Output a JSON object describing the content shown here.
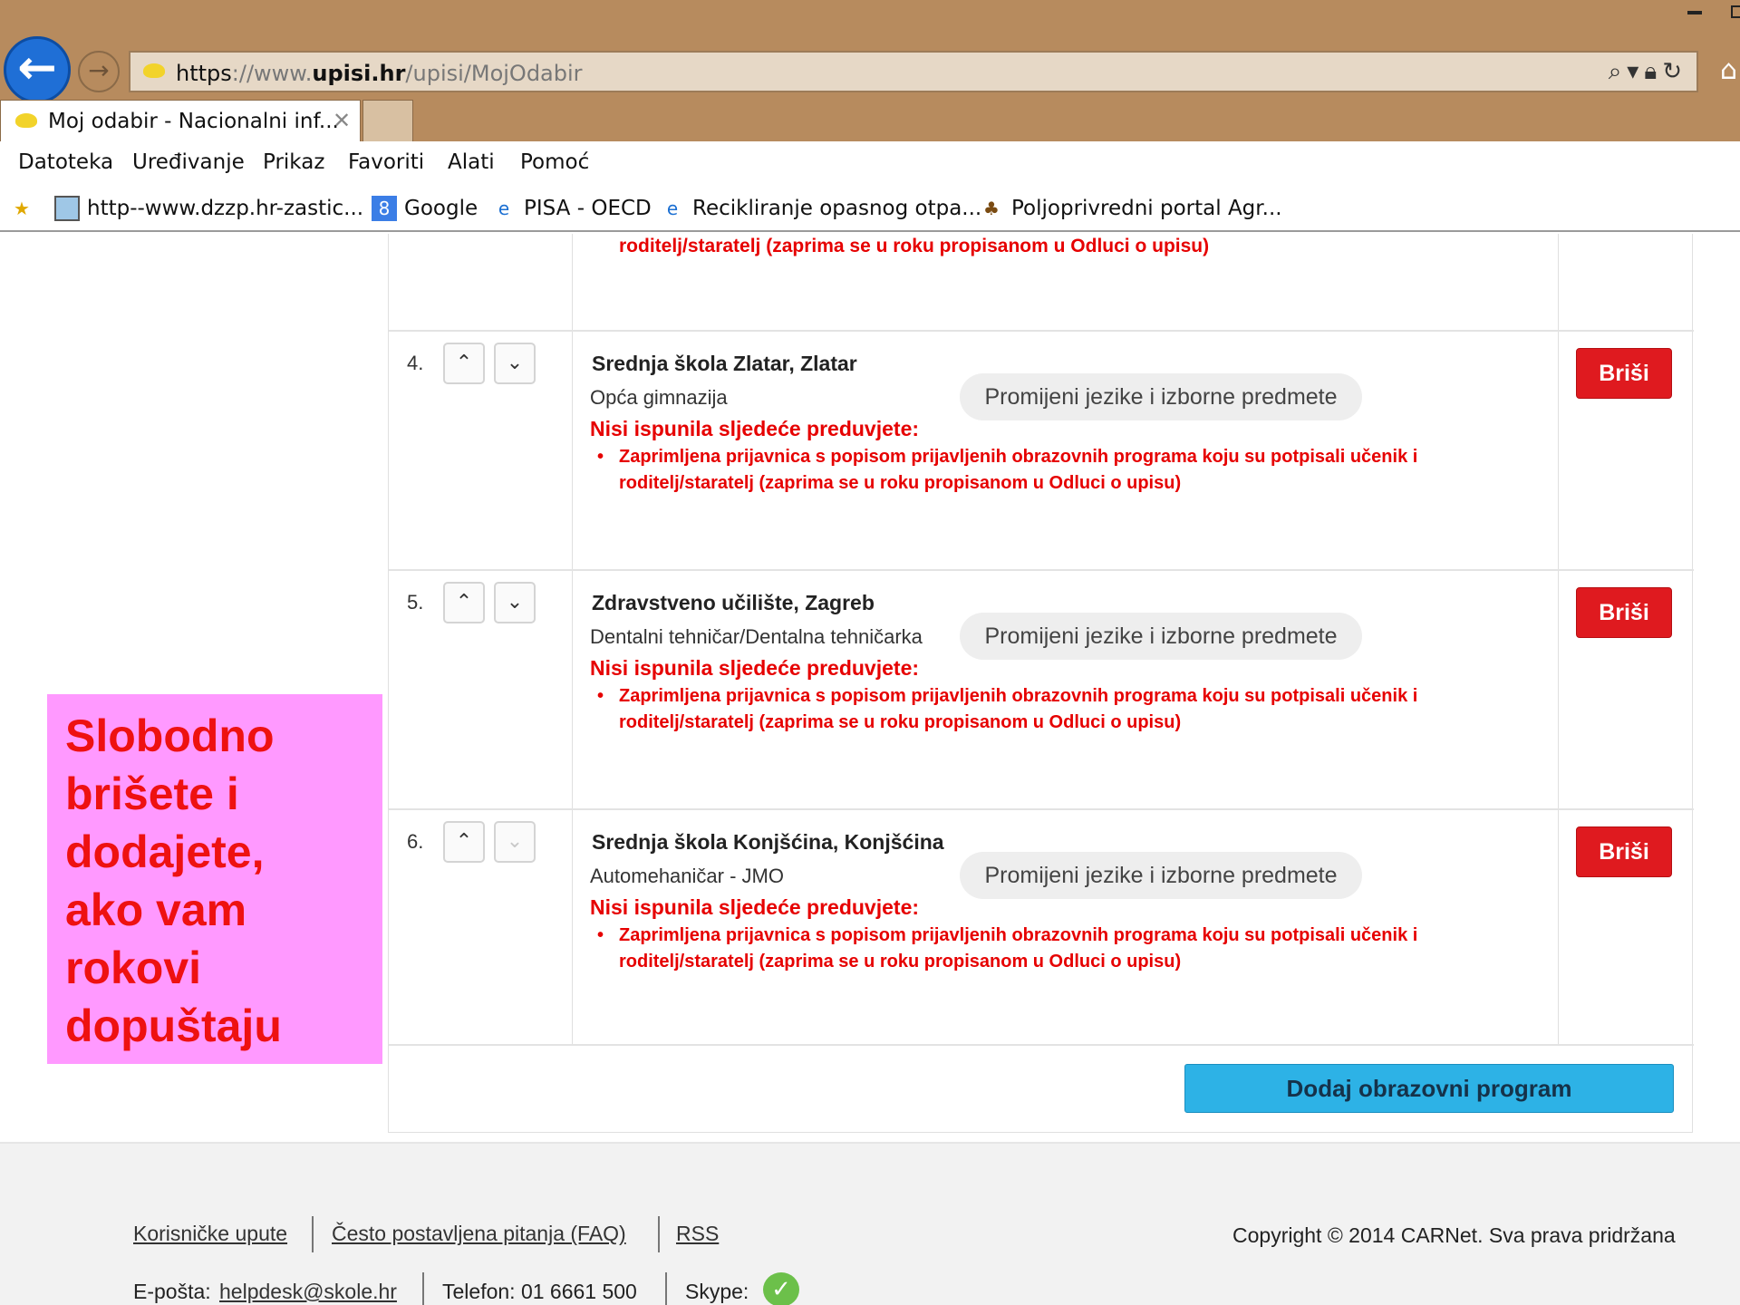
{
  "browser": {
    "url_scheme": "https",
    "url_prefix": "://www.",
    "url_domain": "upisi.hr",
    "url_path": "/upisi/MojOdabir",
    "tab_title": "Moj odabir - Nacionalni inf...",
    "menu": [
      "Datoteka",
      "Uređivanje",
      "Prikaz",
      "Favoriti",
      "Alati",
      "Pomoć"
    ],
    "favorites": [
      {
        "icon": "image-icon",
        "label": "http--www.dzzp.hr-zastic..."
      },
      {
        "icon": "google-icon",
        "label": "Google"
      },
      {
        "icon": "ie-page-icon",
        "label": "PISA - OECD"
      },
      {
        "icon": "ie-page-icon",
        "label": "Recikliranje opasnog otpa..."
      },
      {
        "icon": "plant-icon",
        "label": "Poljoprivredni portal  Agr..."
      }
    ]
  },
  "list": {
    "partial_text": "roditelj/staratelj (zaprima se u roku propisanom u Odluci o upisu)",
    "change_label": "Promijeni jezike i izborne predmete",
    "delete_label": "Briši",
    "warning_title": "Nisi ispunila sljedeće preduvjete:",
    "entries": [
      {
        "rank": "4.",
        "school": "Srednja škola Zlatar, Zlatar",
        "program": "Opća gimnazija",
        "warning": "Zaprimljena prijavnica s popisom prijavljenih obrazovnih programa koju su potpisali učenik i roditelj/staratelj (zaprima se u roku propisanom u Odluci o upisu)",
        "down_enabled": true
      },
      {
        "rank": "5.",
        "school": "Zdravstveno učilište, Zagreb",
        "program": "Dentalni tehničar/Dentalna tehničarka",
        "warning": "Zaprimljena prijavnica s popisom prijavljenih obrazovnih programa koju su potpisali učenik i roditelj/staratelj (zaprima se u roku propisanom u Odluci o upisu)",
        "down_enabled": true
      },
      {
        "rank": "6.",
        "school": "Srednja škola Konjšćina, Konjšćina",
        "program": "Automehaničar - JMO",
        "warning": "Zaprimljena prijavnica s popisom prijavljenih obrazovnih programa koju su potpisali učenik i roditelj/staratelj (zaprima se u roku propisanom u Odluci o upisu)",
        "down_enabled": false
      }
    ],
    "add_label": "Dodaj obrazovni program"
  },
  "callout": {
    "text": "Slobodno\nbrišete i\ndodajete,\nako vam\nrokovi\ndopuštaju",
    "bg_color": "#ff99ff",
    "text_color": "#ee1111"
  },
  "footer": {
    "links": [
      "Korisničke upute",
      "Često postavljena pitanja (FAQ)",
      "RSS"
    ],
    "copyright": "Copyright © 2014 CARNet. Sva prava pridržana",
    "email_label": "E-pošta:",
    "email": "helpdesk@skole.hr",
    "phone": "Telefon: 01 6661 500",
    "skype_label": "Skype:"
  },
  "colors": {
    "chrome": "#b78b5e",
    "delete": "#df1a1f",
    "add": "#2db2e6",
    "warning": "#e60000"
  }
}
